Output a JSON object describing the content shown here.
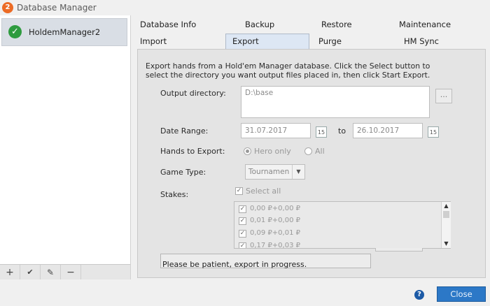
{
  "window": {
    "title": "Database Manager",
    "app_icon": "2"
  },
  "sidebar": {
    "databases": [
      {
        "label": "HoldemManager2",
        "status_icon": "check-circle-icon"
      }
    ],
    "toolbar": [
      {
        "name": "add-button",
        "glyph": "+"
      },
      {
        "name": "set-default-button",
        "glyph": "✔"
      },
      {
        "name": "edit-button",
        "glyph": "✎"
      },
      {
        "name": "remove-button",
        "glyph": "−"
      }
    ]
  },
  "tabs": {
    "row1": [
      "Database Info",
      "Backup",
      "Restore",
      "Maintenance"
    ],
    "row2": [
      "Import",
      "Export",
      "Purge",
      "HM Sync"
    ],
    "active": "Export"
  },
  "export": {
    "description": "Export hands from a Hold'em Manager database.  Click the Select button to select the directory you want output files placed in, then click Start Export.",
    "output_directory_label": "Output directory:",
    "output_directory_value": "D:\\base",
    "browse_button": "...",
    "date_range_label": "Date Range:",
    "date_from": "31.07.2017",
    "date_to": "26.10.2017",
    "date_to_label": "to",
    "calendar_icon_text": "15",
    "hands_label": "Hands to Export:",
    "hands_options": [
      "Hero only",
      "All"
    ],
    "hands_selected": "Hero only",
    "game_type_label": "Game Type:",
    "game_type_value": "Tournamen",
    "stakes_label": "Stakes:",
    "select_all_label": "Select all",
    "stakes": [
      "0,00 ₽+0,00 ₽",
      "0,01 ₽+0,00 ₽",
      "0,09 ₽+0,01 ₽",
      "0,17 ₽+0,03 ₽"
    ],
    "status_text": "Please be patient, export in progress."
  },
  "footer": {
    "help_glyph": "?",
    "close_label": "Close"
  },
  "colors": {
    "accent": "#2c78c7",
    "check_green": "#2e9b3f",
    "app_orange": "#ec6b25"
  }
}
